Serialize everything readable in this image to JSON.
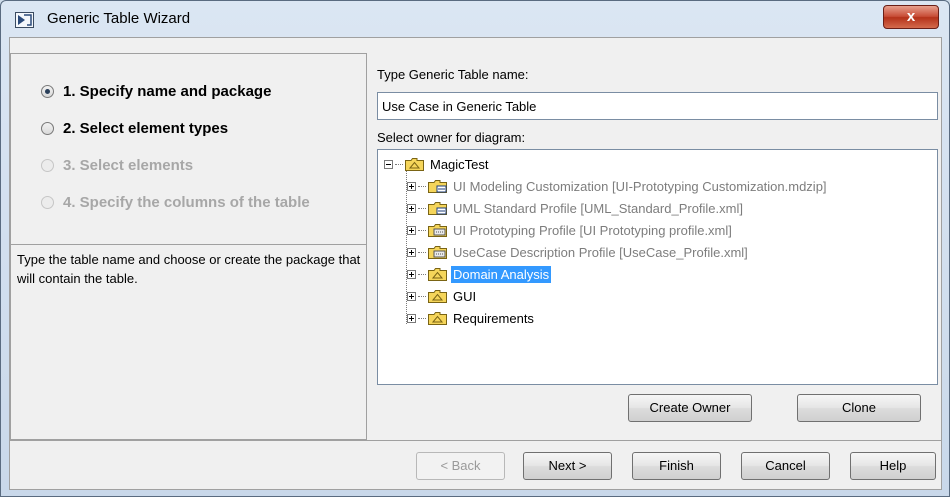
{
  "window": {
    "title": "Generic Table Wizard",
    "close_label": "x"
  },
  "steps": [
    {
      "label": "1. Specify name and package",
      "state": "selected"
    },
    {
      "label": "2. Select element types",
      "state": "enabled"
    },
    {
      "label": "3. Select elements",
      "state": "disabled"
    },
    {
      "label": "4. Specify the columns of the table",
      "state": "disabled"
    }
  ],
  "help_text": "Type the table name and choose or create the package that will contain the table.",
  "name_field": {
    "label": "Type Generic Table name:",
    "value": "Use Case in Generic Table"
  },
  "owner_tree": {
    "label": "Select owner for diagram:",
    "root": "MagicTest",
    "children": [
      {
        "label": "UI Modeling Customization [UI-Prototyping Customization.mdzip]",
        "icon": "shared-package-icon",
        "greyed": true
      },
      {
        "label": "UML Standard Profile [UML_Standard_Profile.xml]",
        "icon": "shared-package-icon",
        "greyed": true
      },
      {
        "label": "UI Prototyping Profile [UI Prototyping profile.xml]",
        "icon": "profile-icon",
        "greyed": true
      },
      {
        "label": "UseCase Description Profile [UseCase_Profile.xml]",
        "icon": "profile-icon",
        "greyed": true
      },
      {
        "label": "Domain Analysis",
        "icon": "package-icon",
        "selected": true
      },
      {
        "label": "GUI",
        "icon": "package-icon"
      },
      {
        "label": "Requirements",
        "icon": "package-icon"
      }
    ]
  },
  "owner_buttons": {
    "create_owner": "Create Owner",
    "clone": "Clone"
  },
  "footer_buttons": {
    "back": "< Back",
    "next": "Next >",
    "finish": "Finish",
    "cancel": "Cancel",
    "help": "Help"
  }
}
